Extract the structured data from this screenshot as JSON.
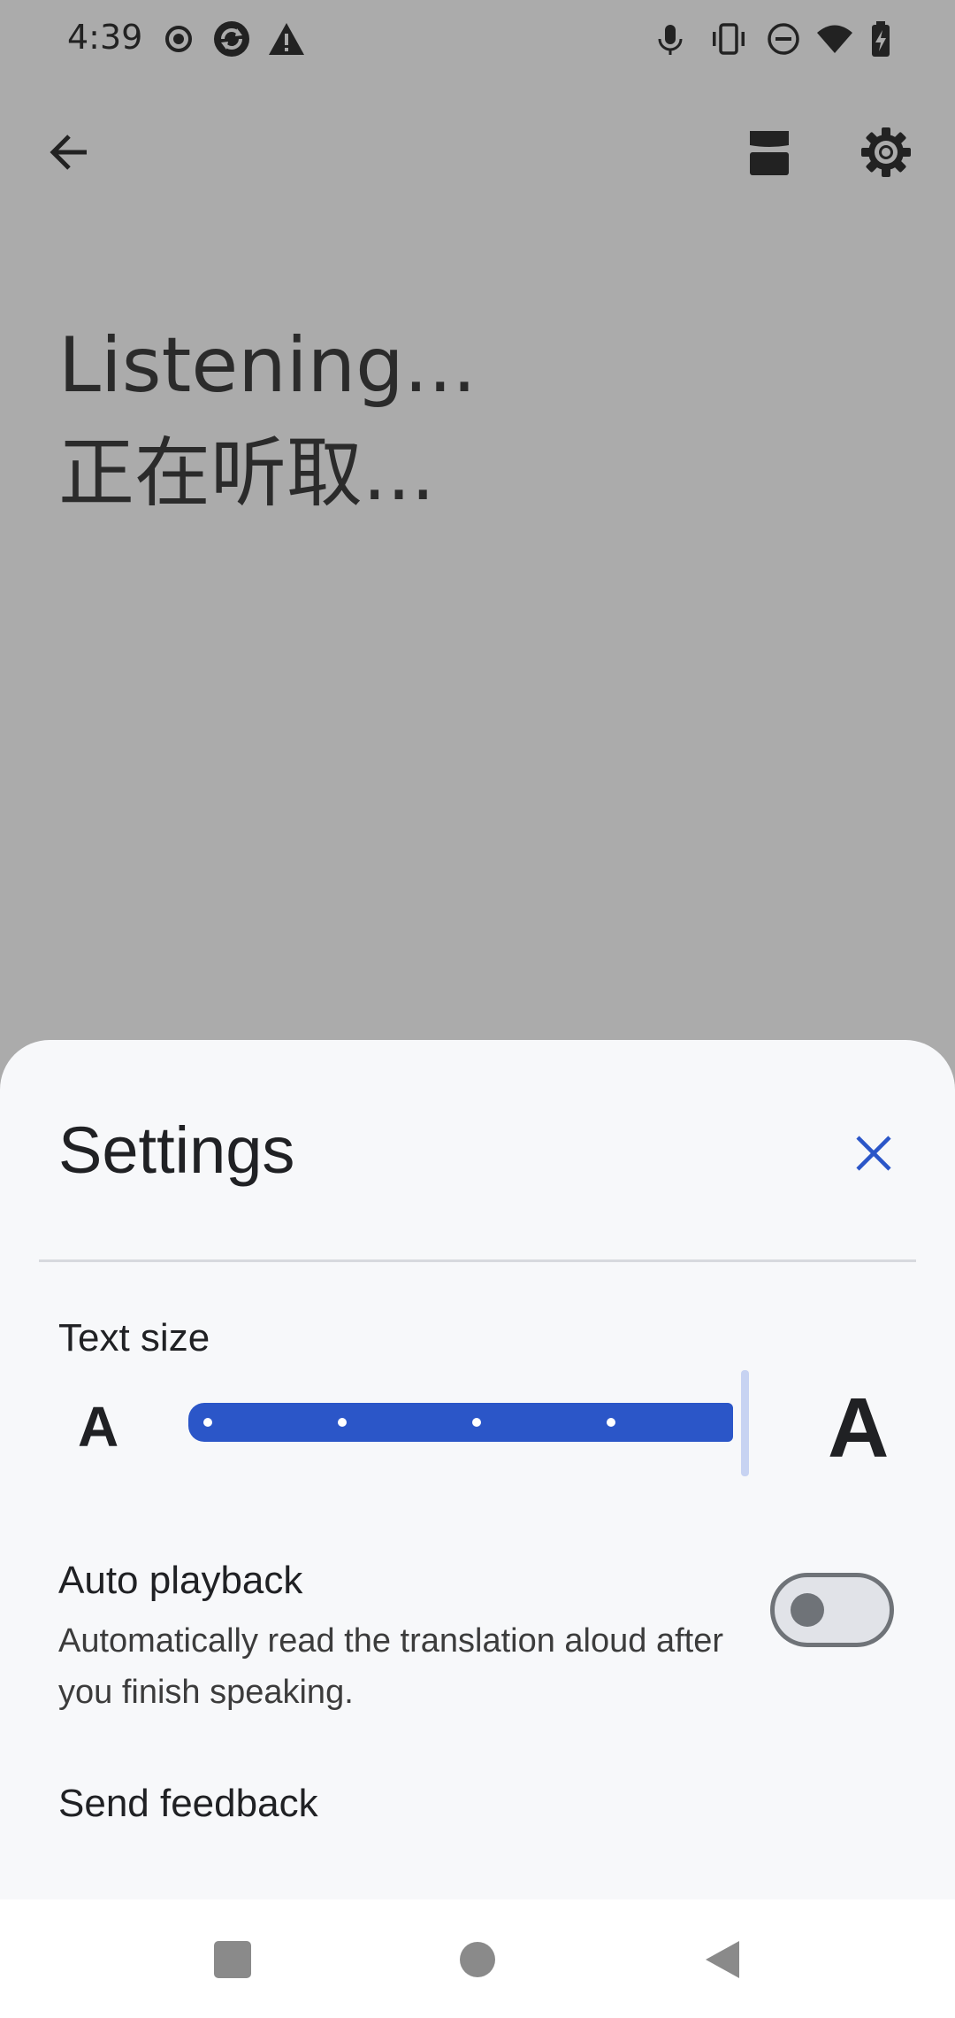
{
  "status_bar": {
    "time": "4:39",
    "left_icons": [
      "record-icon",
      "sync-icon",
      "warning-icon"
    ],
    "right_icons": [
      "mic-icon",
      "vibrate-icon",
      "do-not-disturb-icon",
      "wifi-icon",
      "battery-charging-icon"
    ]
  },
  "app_bar": {
    "icons": [
      "back-arrow-icon",
      "display-mode-icon",
      "gear-icon"
    ]
  },
  "transcript": {
    "source_text": "Listening...",
    "target_text": "正在听取..."
  },
  "settings_sheet": {
    "title": "Settings",
    "close_icon": "close-icon",
    "text_size": {
      "label": "Text size",
      "small_glyph": "A",
      "large_glyph": "A",
      "steps": 5,
      "value_fraction": 1.0
    },
    "auto_playback": {
      "label": "Auto playback",
      "description": "Automatically read the translation aloud after you finish speaking.",
      "enabled": false
    },
    "send_feedback_label": "Send feedback"
  },
  "colors": {
    "accent": "#2b56c8",
    "sheet_background": "#f7f8fa",
    "scrim": "#ababab"
  },
  "nav_bar": {
    "icons": [
      "recents-icon",
      "home-icon",
      "back-icon"
    ]
  }
}
